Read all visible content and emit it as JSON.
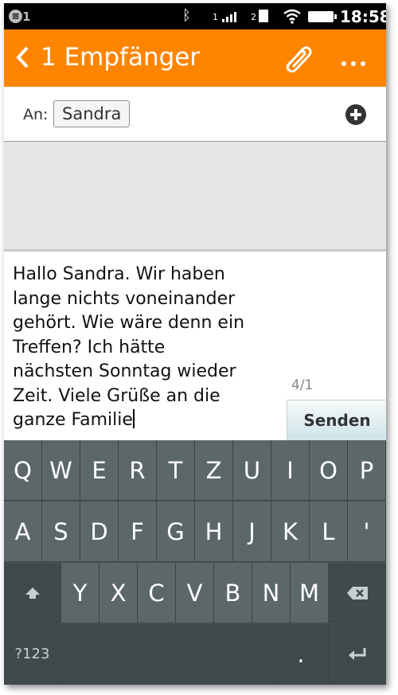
{
  "status": {
    "notification_count": "1",
    "sim1_label": "1",
    "sim2_label": "2",
    "time": "18:58"
  },
  "header": {
    "back_icon": "chevron-left-icon",
    "title": "1 Empfänger",
    "attach_icon": "paperclip-icon",
    "more_icon": "more-dots-icon",
    "background_color": "#ff8500"
  },
  "recipients": {
    "to_label": "An:",
    "recipient_chip": "Sandra",
    "add_icon": "plus-circle-icon"
  },
  "compose": {
    "message_lines": [
      "Hallo Sandra. Wir haben",
      "lange nichts voneinander",
      "gehört. Wie wäre denn ein",
      "Treffen? Ich hätte",
      "nächsten Sonntag wieder",
      "Zeit. Viele Grüße an die",
      "ganze Familie"
    ],
    "char_counter": "4/1",
    "send_label": "Senden"
  },
  "keyboard": {
    "row1": [
      "Q",
      "W",
      "E",
      "R",
      "T",
      "Z",
      "U",
      "I",
      "O",
      "P"
    ],
    "row2": [
      "A",
      "S",
      "D",
      "F",
      "G",
      "H",
      "J",
      "K",
      "L",
      "'"
    ],
    "row3": [
      "Y",
      "X",
      "C",
      "V",
      "B",
      "N",
      "M"
    ],
    "shift_icon": "shift-arrow-icon",
    "backspace_icon": "backspace-icon",
    "symbols_label": "?123",
    "period_label": ".",
    "enter_icon": "enter-return-icon"
  }
}
